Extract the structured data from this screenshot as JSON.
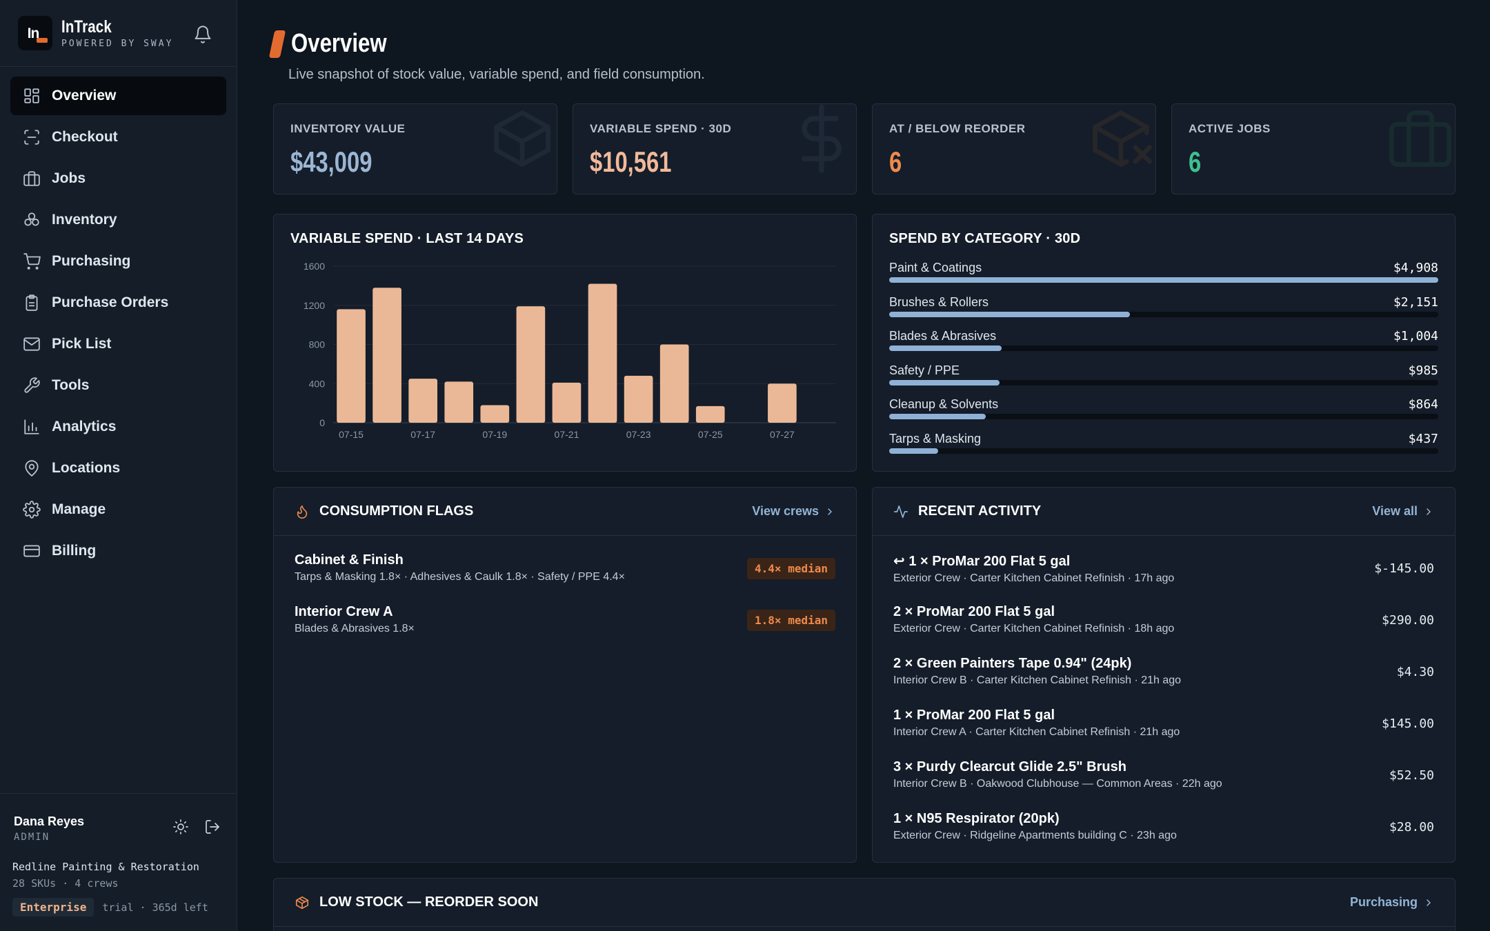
{
  "brand": {
    "name": "InTrack",
    "sub": "POWERED BY SWAY",
    "logo_text": "In"
  },
  "nav": [
    {
      "label": "Overview",
      "icon": "dashboard-icon",
      "active": true
    },
    {
      "label": "Checkout",
      "icon": "scan-icon"
    },
    {
      "label": "Jobs",
      "icon": "briefcase-icon"
    },
    {
      "label": "Inventory",
      "icon": "boxes-icon"
    },
    {
      "label": "Purchasing",
      "icon": "cart-icon"
    },
    {
      "label": "Purchase Orders",
      "icon": "clipboard-icon"
    },
    {
      "label": "Pick List",
      "icon": "mail-icon"
    },
    {
      "label": "Tools",
      "icon": "wrench-icon"
    },
    {
      "label": "Analytics",
      "icon": "bar-chart-icon"
    },
    {
      "label": "Locations",
      "icon": "map-pin-icon"
    },
    {
      "label": "Manage",
      "icon": "gear-icon"
    },
    {
      "label": "Billing",
      "icon": "credit-card-icon"
    }
  ],
  "user": {
    "name": "Dana Reyes",
    "role": "ADMIN"
  },
  "org": {
    "name": "Redline Painting & Restoration",
    "meta": "28 SKUs · 4 crews",
    "plan": "Enterprise",
    "trial": "trial · 365d left"
  },
  "page": {
    "title": "Overview",
    "subtitle": "Live snapshot of stock value, variable spend, and field consumption."
  },
  "stats": [
    {
      "label": "INVENTORY VALUE",
      "value": "$43,009",
      "color": "#9cb6d4"
    },
    {
      "label": "VARIABLE SPEND · 30D",
      "value": "$10,561",
      "color": "#f1b99a"
    },
    {
      "label": "AT / BELOW REORDER",
      "value": "6",
      "color": "#ee8a4d"
    },
    {
      "label": "ACTIVE JOBS",
      "value": "6",
      "color": "#3fbf8f"
    }
  ],
  "chart_title": "VARIABLE SPEND · LAST 14 DAYS",
  "chart_data": {
    "type": "bar",
    "title": "VARIABLE SPEND · LAST 14 DAYS",
    "categories": [
      "07-15",
      "07-16",
      "07-17",
      "07-18",
      "07-19",
      "07-20",
      "07-21",
      "07-22",
      "07-23",
      "07-24",
      "07-25",
      "07-26",
      "07-27",
      "07-28"
    ],
    "tick_labels": [
      "07-15",
      "07-17",
      "07-19",
      "07-21",
      "07-23",
      "07-25",
      "07-27"
    ],
    "values": [
      1160,
      1380,
      450,
      420,
      180,
      1190,
      410,
      1420,
      480,
      800,
      170,
      0,
      400,
      0
    ],
    "ylim": [
      0,
      1600
    ],
    "yticks": [
      0,
      400,
      800,
      1200,
      1600
    ],
    "color": "#ebb897",
    "grid": true
  },
  "categories_title": "SPEND BY CATEGORY · 30D",
  "spend_categories": [
    {
      "name": "Paint & Coatings",
      "value": "$4,908",
      "fraction": 1.0
    },
    {
      "name": "Brushes & Rollers",
      "value": "$2,151",
      "fraction": 0.438
    },
    {
      "name": "Blades & Abrasives",
      "value": "$1,004",
      "fraction": 0.205
    },
    {
      "name": "Safety / PPE",
      "value": "$985",
      "fraction": 0.201
    },
    {
      "name": "Cleanup & Solvents",
      "value": "$864",
      "fraction": 0.176
    },
    {
      "name": "Tarps & Masking",
      "value": "$437",
      "fraction": 0.089
    }
  ],
  "flags": {
    "title": "CONSUMPTION FLAGS",
    "link": "View crews",
    "items": [
      {
        "name": "Cabinet & Finish",
        "detail": "Tarps & Masking 1.8× · Adhesives & Caulk 1.8× · Safety / PPE 4.4×",
        "badge": "4.4× median"
      },
      {
        "name": "Interior Crew A",
        "detail": "Blades & Abrasives 1.8×",
        "badge": "1.8× median"
      }
    ]
  },
  "activity": {
    "title": "RECENT ACTIVITY",
    "link": "View all",
    "items": [
      {
        "title": "↩ 1 × ProMar 200 Flat 5 gal",
        "sub": "Exterior Crew · Carter Kitchen Cabinet Refinish · 17h ago",
        "amount": "$-145.00"
      },
      {
        "title": "2 × ProMar 200 Flat 5 gal",
        "sub": "Exterior Crew · Carter Kitchen Cabinet Refinish · 18h ago",
        "amount": "$290.00"
      },
      {
        "title": "2 × Green Painters Tape 0.94\" (24pk)",
        "sub": "Interior Crew B · Carter Kitchen Cabinet Refinish · 21h ago",
        "amount": "$4.30"
      },
      {
        "title": "1 × ProMar 200 Flat 5 gal",
        "sub": "Interior Crew A · Carter Kitchen Cabinet Refinish · 21h ago",
        "amount": "$145.00"
      },
      {
        "title": "3 × Purdy Clearcut Glide 2.5\" Brush",
        "sub": "Interior Crew B · Oakwood Clubhouse — Common Areas · 22h ago",
        "amount": "$52.50"
      },
      {
        "title": "1 × N95 Respirator (20pk)",
        "sub": "Exterior Crew · Ridgeline Apartments building C · 23h ago",
        "amount": "$28.00"
      }
    ]
  },
  "low_stock": {
    "title": "LOW STOCK — REORDER SOON",
    "link": "Purchasing"
  }
}
